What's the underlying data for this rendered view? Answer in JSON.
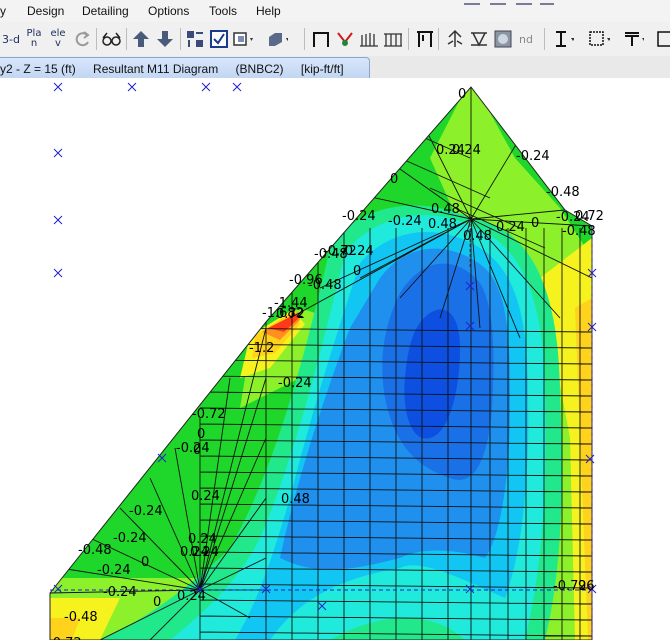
{
  "menu": [
    "y",
    "Design",
    "Detailing",
    "Options",
    "Tools",
    "Help"
  ],
  "toolbar": {
    "view_3d": "3-d",
    "plan": "Pla n",
    "elev": "ele v",
    "nd": "nd"
  },
  "tab": {
    "view": "y2 - Z = 15 (ft)",
    "diagram": "Resultant M11 Diagram",
    "combo": "(BNBC2)",
    "units": "[kip-ft/ft]"
  },
  "colors": {
    "contour": [
      "#ff3a1a",
      "#ff9020",
      "#ffd21c",
      "#f5f21e",
      "#8cf02a",
      "#1fd62a",
      "#22e88c",
      "#20eadc",
      "#12c6f4",
      "#1f90ee",
      "#1a70e6",
      "#0d4fe0"
    ],
    "mesh": "#111111",
    "marker": "#2020cc"
  },
  "icons": [
    "undo-icon",
    "glasses-icon",
    "arrow-up-icon",
    "arrow-down-icon",
    "select-icon",
    "checkbox-icon",
    "box-icon",
    "frame-icon",
    "link-icon",
    "spring-icon",
    "shell-icon",
    "brace-icon",
    "support-icon",
    "beam-icon",
    "section-icon",
    "column-icon"
  ],
  "contour_labels": [
    {
      "text": "0"
    },
    {
      "text": "0.24"
    },
    {
      "text": "0.24"
    },
    {
      "text": "-0.24"
    },
    {
      "text": "0"
    },
    {
      "text": "-0.48"
    },
    {
      "text": "-0.24"
    },
    {
      "text": "-0.24"
    },
    {
      "text": "0.48"
    },
    {
      "text": "0.48"
    },
    {
      "text": "0.24"
    },
    {
      "text": "0"
    },
    {
      "text": "-0.24"
    },
    {
      "text": "0.72"
    },
    {
      "text": "-0.48"
    },
    {
      "text": "0.48"
    },
    {
      "text": "-0.72"
    },
    {
      "text": "-0.48"
    },
    {
      "text": "-0.24"
    },
    {
      "text": "0"
    },
    {
      "text": "-0.96"
    },
    {
      "text": "-0.48"
    },
    {
      "text": "-1.44"
    },
    {
      "text": "-1.682"
    },
    {
      "text": "0.72"
    },
    {
      "text": "-1.2"
    },
    {
      "text": "-0.24"
    },
    {
      "text": "-0.72"
    },
    {
      "text": "0"
    },
    {
      "text": "-0.24"
    },
    {
      "text": "0"
    },
    {
      "text": "0.24"
    },
    {
      "text": "0.48"
    },
    {
      "text": "-0.24"
    },
    {
      "text": "-0.24"
    },
    {
      "text": "0.24"
    },
    {
      "text": "-0.48"
    },
    {
      "text": "0.24"
    },
    {
      "text": "0.24"
    },
    {
      "text": "-0.24"
    },
    {
      "text": "0"
    },
    {
      "text": "-0.24"
    },
    {
      "text": "0"
    },
    {
      "text": "0.24"
    },
    {
      "text": "-0.48"
    },
    {
      "text": "-0.72"
    },
    {
      "text": "-0.72"
    },
    {
      "text": "96"
    }
  ]
}
